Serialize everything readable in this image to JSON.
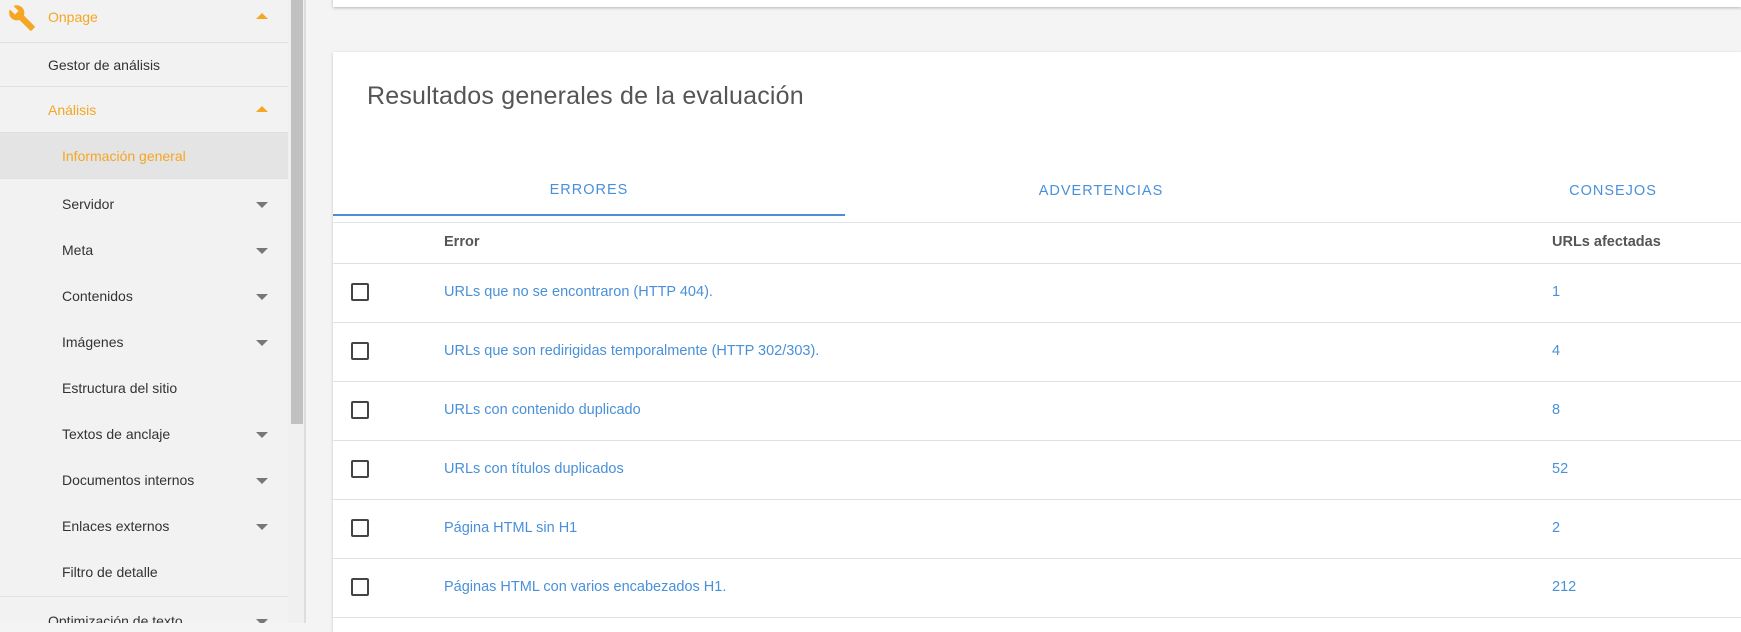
{
  "sidebar": {
    "onpage_label": "Onpage",
    "gestor_label": "Gestor de análisis",
    "analisis_label": "Análisis",
    "items": [
      {
        "label": "Información general"
      },
      {
        "label": "Servidor"
      },
      {
        "label": "Meta"
      },
      {
        "label": "Contenidos"
      },
      {
        "label": "Imágenes"
      },
      {
        "label": "Estructura del sitio"
      },
      {
        "label": "Textos de anclaje"
      },
      {
        "label": "Documentos internos"
      },
      {
        "label": "Enlaces externos"
      },
      {
        "label": "Filtro de detalle"
      }
    ],
    "optimizacion_label": "Optimización de texto"
  },
  "main": {
    "title": "Resultados generales de la evaluación",
    "tabs": [
      {
        "label": "ERRORES",
        "active": true
      },
      {
        "label": "ADVERTENCIAS",
        "active": false
      },
      {
        "label": "CONSEJOS",
        "active": false
      }
    ],
    "table": {
      "col_error": "Error",
      "col_urls": "URLs afectadas",
      "rows": [
        {
          "error": "URLs que no se encontraron (HTTP 404).",
          "count": "1"
        },
        {
          "error": "URLs que son redirigidas temporalmente (HTTP 302/303).",
          "count": "4"
        },
        {
          "error": "URLs con contenido duplicado",
          "count": "8"
        },
        {
          "error": "URLs con títulos duplicados",
          "count": "52"
        },
        {
          "error": "Página HTML sin H1",
          "count": "2"
        },
        {
          "error": "Páginas HTML con varios encabezados H1.",
          "count": "212"
        }
      ]
    }
  },
  "colors": {
    "accent_orange": "#f5a623",
    "link_blue": "#4a90d9",
    "sidebar_bg": "#f2f2f2",
    "active_item_bg": "#e4e4e4"
  }
}
